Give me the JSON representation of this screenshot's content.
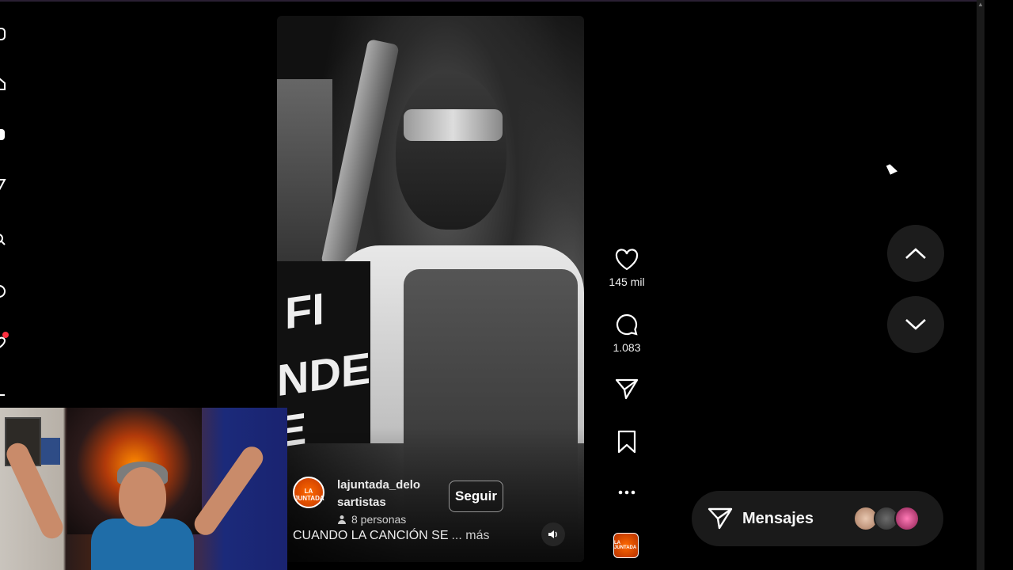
{
  "post": {
    "username_line1": "lajuntada_delo",
    "username_line2": "sartistas",
    "followers": "8 personas",
    "follow_label": "Seguir",
    "caption": "CUANDO LA CANCIÓN SE",
    "more_label": "... más",
    "avatar_text": "LA JUNTADA",
    "video_sign_line1": "FI",
    "video_sign_line2": "NDE E"
  },
  "actions": {
    "likes": "145 mil",
    "comments": "1.083"
  },
  "messages": {
    "label": "Mensajes"
  },
  "icons": {
    "like": "heart-icon",
    "comment": "comment-icon",
    "share": "send-icon",
    "save": "bookmark-icon",
    "more": "more-icon",
    "up": "chevron-up-icon",
    "down": "chevron-down-icon",
    "volume": "speaker-icon"
  },
  "colors": {
    "background": "#000000",
    "notification": "#ff3040",
    "panel": "#1a1a1a",
    "brand_orange": "#ff6a00"
  }
}
